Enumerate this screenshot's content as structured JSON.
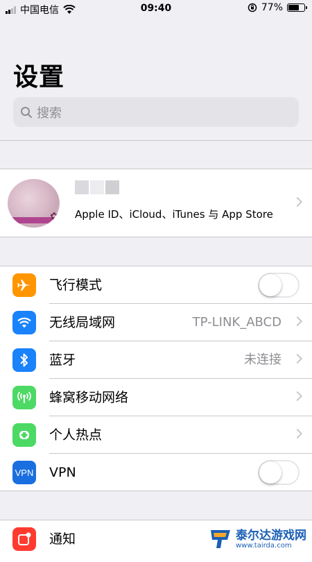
{
  "status_bar": {
    "carrier": "中国电信",
    "time": "09:40",
    "battery_percent_text": "77%",
    "battery_level": 0.77
  },
  "page": {
    "title": "设置"
  },
  "search": {
    "placeholder": "搜索"
  },
  "profile": {
    "subtitle": "Apple ID、iCloud、iTunes 与 App Store"
  },
  "settings": [
    {
      "label": "飞行模式",
      "icon": "airplane-icon",
      "color": "#ff9500",
      "toggle": "off"
    },
    {
      "label": "无线局域网",
      "icon": "wifi-icon",
      "color": "#1a82fb",
      "value": "TP-LINK_ABCD"
    },
    {
      "label": "蓝牙",
      "icon": "bluetooth-icon",
      "color": "#1a82fb",
      "value": "未连接"
    },
    {
      "label": "蜂窝移动网络",
      "icon": "cellular-icon",
      "color": "#4cd964"
    },
    {
      "label": "个人热点",
      "icon": "hotspot-icon",
      "color": "#4cd964"
    },
    {
      "label": "VPN",
      "icon": "vpn-icon",
      "icon_text": "VPN",
      "color": "#1a6fe0",
      "toggle": "off"
    },
    {
      "label": "通知",
      "icon": "notifications-icon",
      "color": "#ff3b30"
    }
  ],
  "watermark": {
    "name": "泰尔达游戏网",
    "url": "www.tairda.com"
  }
}
